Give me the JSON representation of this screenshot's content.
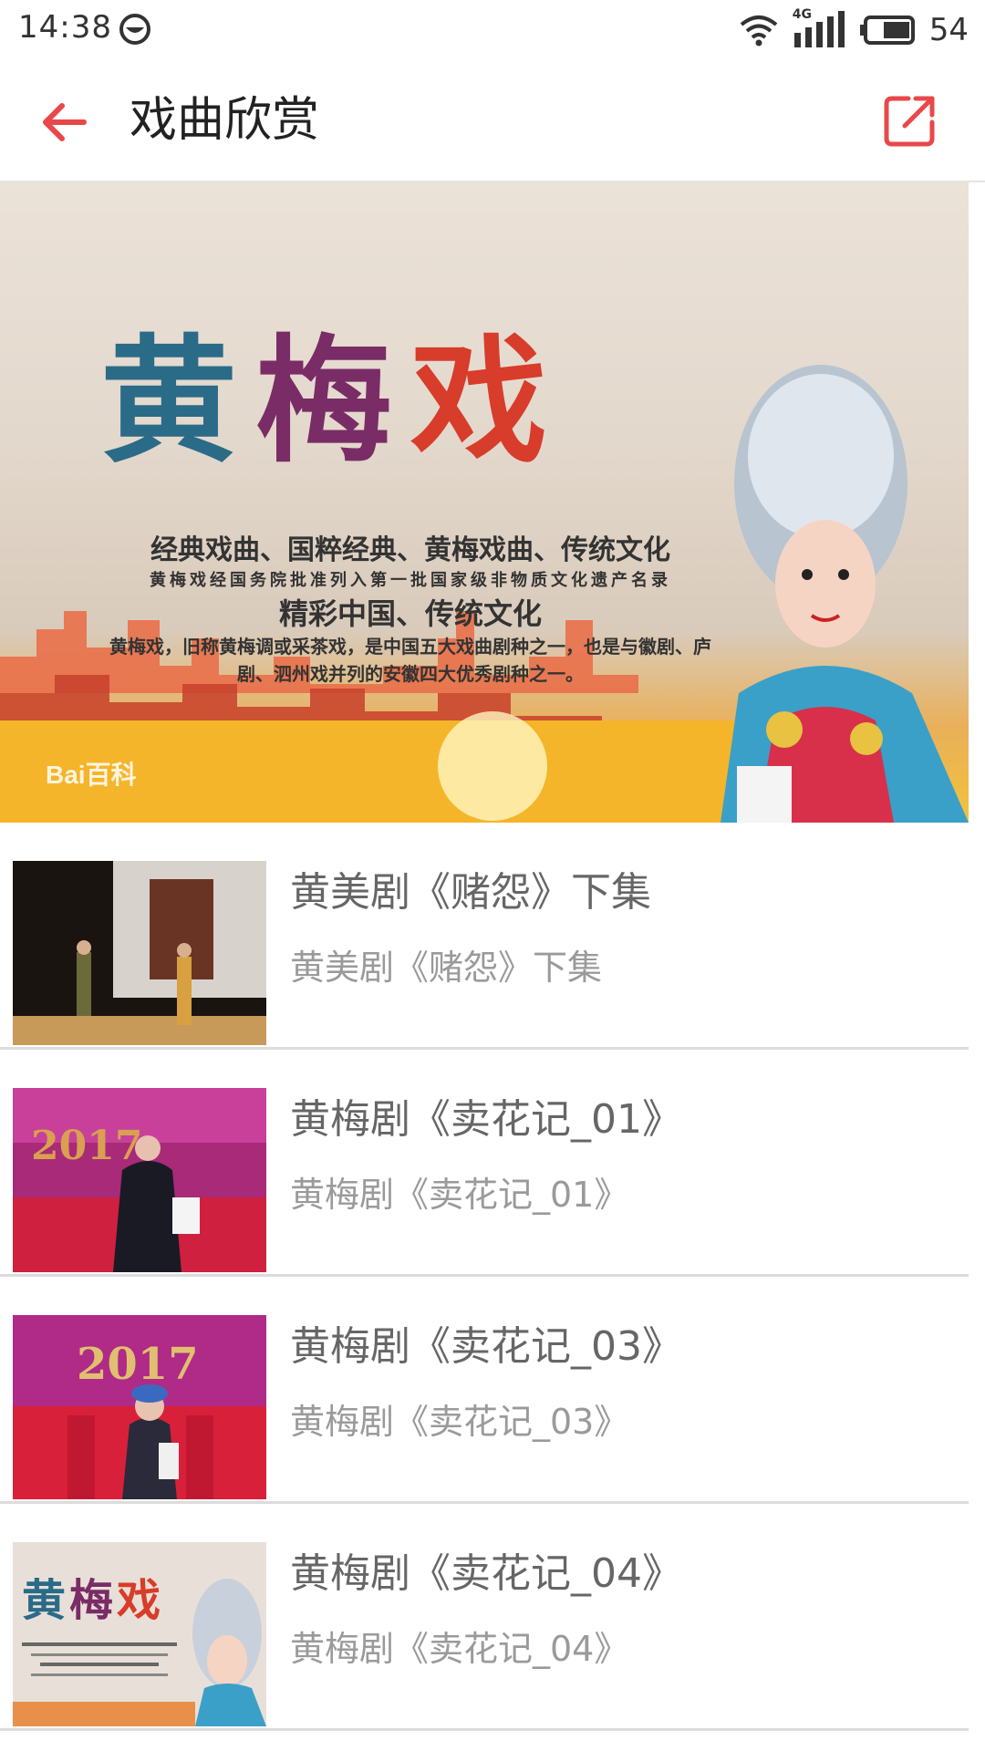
{
  "status_bar": {
    "time": "14:38",
    "network": "4G",
    "battery": "54"
  },
  "app_bar": {
    "title": "戏曲欣赏",
    "back_icon": "arrow-left-icon",
    "share_icon": "share-external-icon",
    "accent_color": "#e8484a"
  },
  "banner": {
    "title_chars": [
      "黄",
      "梅",
      "戏"
    ],
    "slogan_1": "经典戏曲、国粹经典、黄梅戏曲、传统文化",
    "sub_line": "黄梅戏经国务院批准列入第一批国家级非物质文化遗产名录",
    "slogan_2": "精彩中国、传统文化",
    "description": "黄梅戏，旧称黄梅调或采茶戏，是中国五大戏曲剧种之一，也是与徽剧、庐剧、泗州戏并列的安徽四大优秀剧种之一。",
    "watermark": "Bai百科"
  },
  "videos": [
    {
      "title": "黄美剧《赌怨》下集",
      "subtitle": "黄美剧《赌怨》下集"
    },
    {
      "title": "黄梅剧《卖花记_01》",
      "subtitle": "黄梅剧《卖花记_01》"
    },
    {
      "title": "黄梅剧《卖花记_03》",
      "subtitle": "黄梅剧《卖花记_03》"
    },
    {
      "title": "黄梅剧《卖花记_04》",
      "subtitle": "黄梅剧《卖花记_04》"
    }
  ]
}
